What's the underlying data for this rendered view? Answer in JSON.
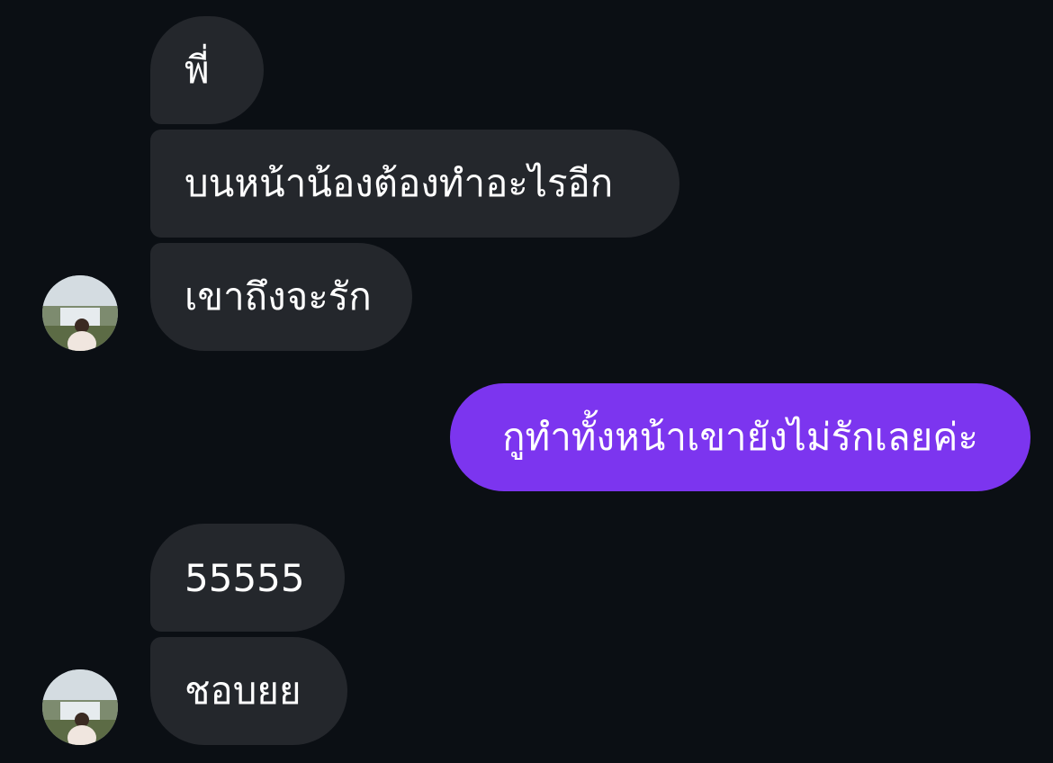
{
  "messages": [
    {
      "sender": "them",
      "text": "พี่"
    },
    {
      "sender": "them",
      "text": "บนหน้าน้องต้องทำอะไรอีก"
    },
    {
      "sender": "them",
      "text": "เขาถึงจะรัก"
    },
    {
      "sender": "me",
      "text": "กูทำทั้งหน้าเขายังไม่รักเลยค่ะ"
    },
    {
      "sender": "them",
      "text": "55555"
    },
    {
      "sender": "them",
      "text": "ชอบยย"
    }
  ],
  "colors": {
    "background": "#0b0f14",
    "incoming_bubble": "#24272c",
    "outgoing_bubble": "#7c35ef",
    "text": "#ffffff"
  },
  "icons": {
    "avatar": "contact-avatar-photo"
  }
}
